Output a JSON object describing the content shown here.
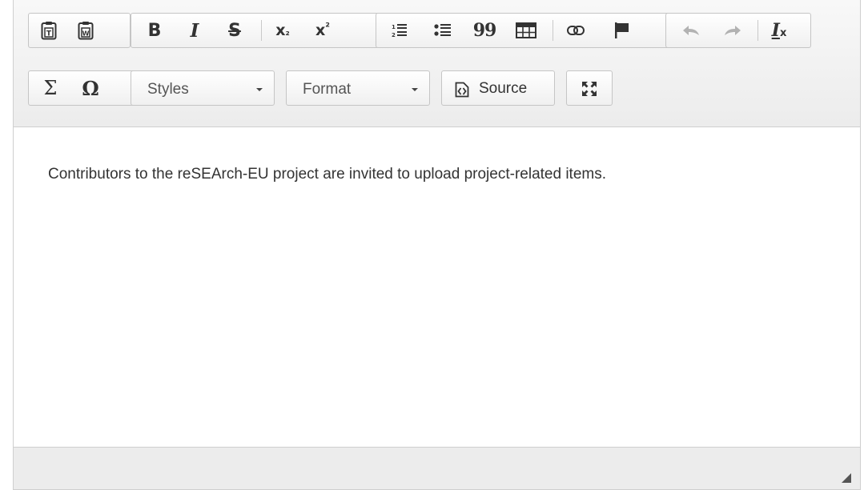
{
  "toolbar": {
    "row1": {
      "clipboard": [
        {
          "icon": "paste-as-text-icon",
          "letter": "T"
        },
        {
          "icon": "paste-from-word-icon",
          "letter": "W"
        }
      ],
      "basicstyles": [
        {
          "icon": "bold-icon",
          "glyph": "B"
        },
        {
          "icon": "italic-icon",
          "glyph": "I"
        },
        {
          "icon": "strikethrough-icon",
          "glyph": "S"
        },
        {
          "icon": "subscript-icon",
          "glyph": "x",
          "mark": "₂"
        },
        {
          "icon": "superscript-icon",
          "glyph": "x",
          "mark": "²"
        }
      ],
      "paragraph": [
        {
          "icon": "numbered-list-icon"
        },
        {
          "icon": "bulleted-list-icon"
        },
        {
          "icon": "blockquote-icon",
          "glyph": "99"
        },
        {
          "icon": "table-icon"
        },
        {
          "icon": "link-icon"
        },
        {
          "icon": "anchor-flag-icon"
        }
      ],
      "history": [
        {
          "icon": "undo-icon",
          "disabled": true
        },
        {
          "icon": "redo-icon",
          "disabled": true
        },
        {
          "icon": "remove-format-icon",
          "glyph": "I",
          "mark": "x"
        }
      ]
    },
    "row2": {
      "insert": [
        {
          "icon": "math-sigma-icon",
          "glyph": "Σ"
        },
        {
          "icon": "special-char-omega-icon",
          "glyph": "Ω"
        }
      ],
      "styles_label": "Styles",
      "format_label": "Format",
      "source_label": "Source",
      "maximize_icon": "maximize-icon"
    }
  },
  "content": {
    "text": "Contributors to the reSEArch-EU project are invited to upload project-related items."
  }
}
